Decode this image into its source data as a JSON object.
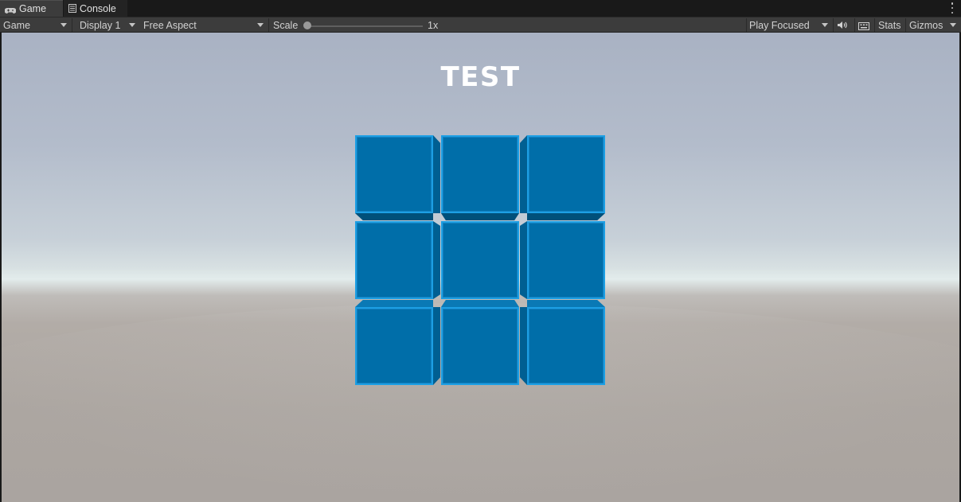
{
  "tabs": [
    {
      "label": "Game",
      "icon": "gamepad-icon",
      "active": true
    },
    {
      "label": "Console",
      "icon": "console-icon",
      "active": false
    }
  ],
  "toolbar": {
    "view_mode": "Game",
    "display": "Display 1",
    "aspect": "Free Aspect",
    "scale_label": "Scale",
    "scale_value": "1x",
    "scale_fraction": 0.0,
    "play_mode": "Play Focused",
    "stats_label": "Stats",
    "gizmos_label": "Gizmos"
  },
  "scene": {
    "title": "TEST",
    "grid_rows": 3,
    "grid_cols": 3,
    "colors": {
      "cube_face": "#006ea9",
      "cube_edge": "#1c9fe4",
      "cube_side": "#00507a"
    }
  }
}
